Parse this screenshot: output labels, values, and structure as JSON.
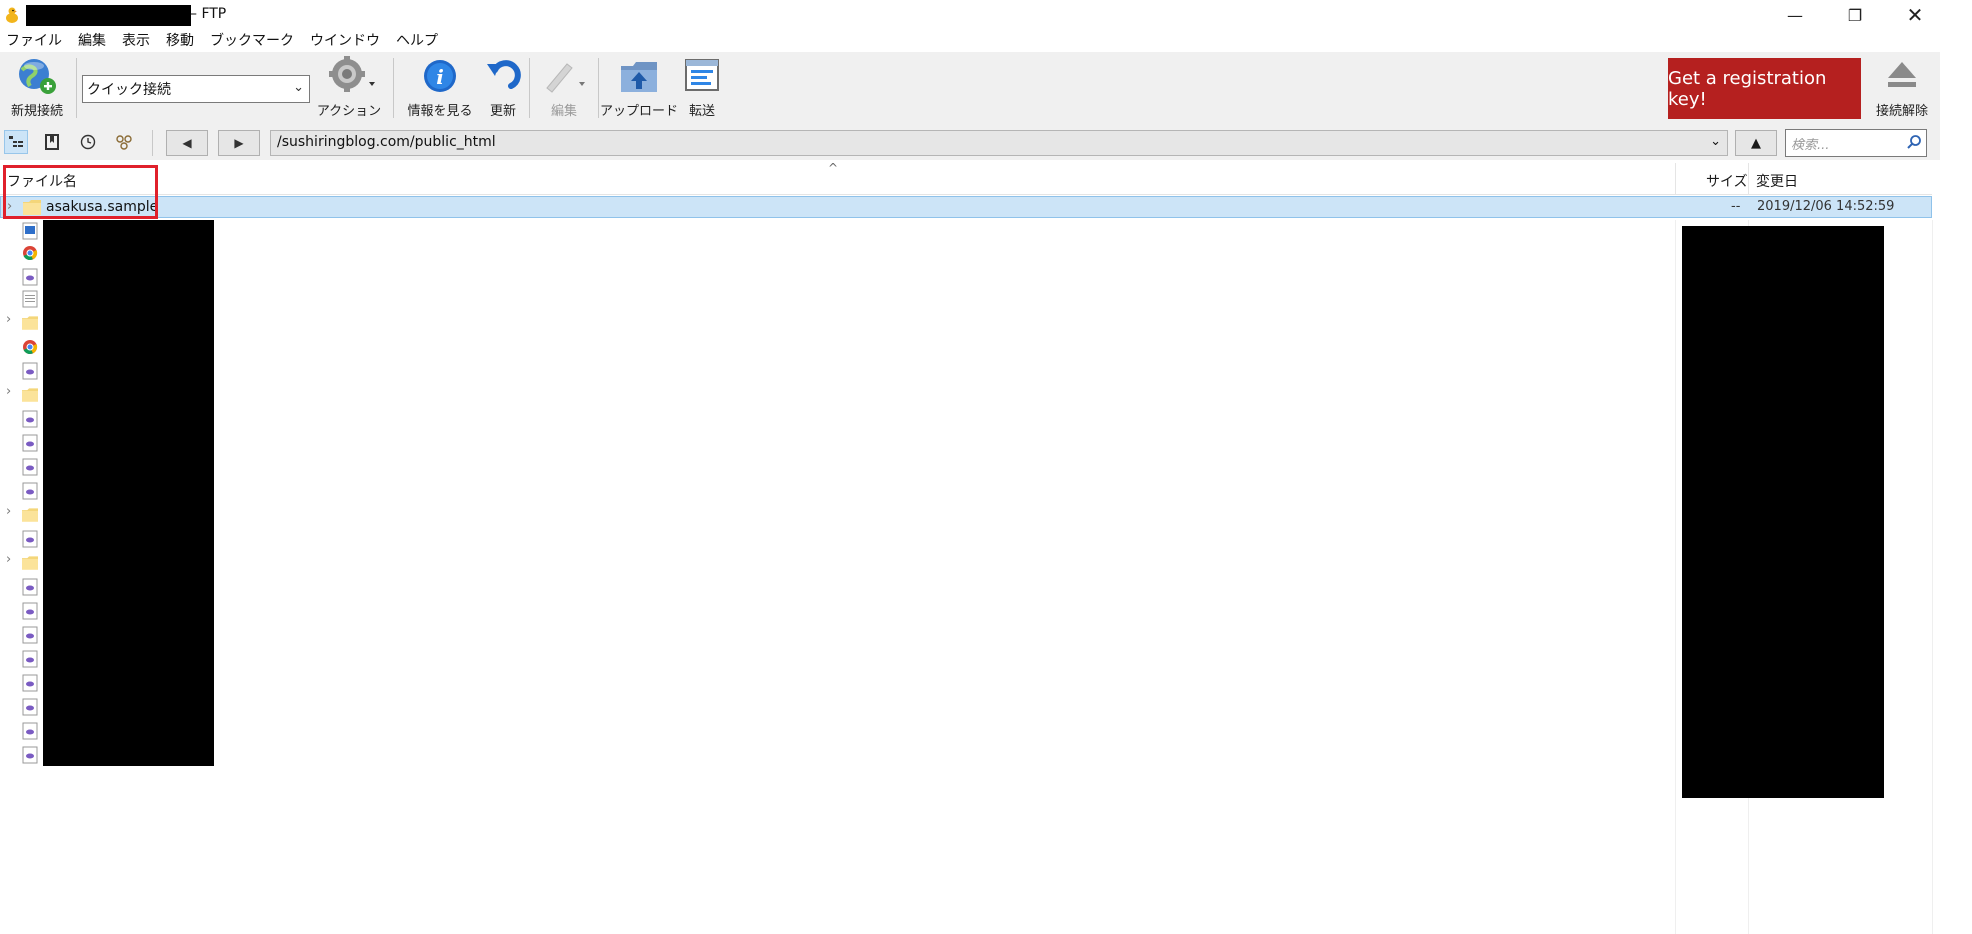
{
  "window": {
    "title_suffix": "– FTP",
    "controls": {
      "minimize": "—",
      "maximize": "❐",
      "close": "✕"
    }
  },
  "menu": [
    "ファイル",
    "編集",
    "表示",
    "移動",
    "ブックマーク",
    "ウインドウ",
    "ヘルプ"
  ],
  "toolbar": {
    "new_connection": "新規接続",
    "quick_connect": "クイック接続",
    "action": "アクション",
    "info": "情報を見る",
    "refresh": "更新",
    "edit": "編集",
    "upload": "アップロード",
    "transfer": "転送",
    "register": "Get a registration key!",
    "disconnect": "接続解除"
  },
  "nav": {
    "path": "/sushiringblog.com/public_html",
    "search_placeholder": "検索..."
  },
  "columns": {
    "name": "ファイル名",
    "size": "サイズ",
    "modified": "変更日"
  },
  "selected_row": {
    "name": "asakusa.sample",
    "size": "--",
    "modified": "2019/12/06 14:52:59"
  },
  "colors": {
    "accent": "#b5201f",
    "selection": "#cce4f7",
    "highlight": "#e0202b"
  }
}
